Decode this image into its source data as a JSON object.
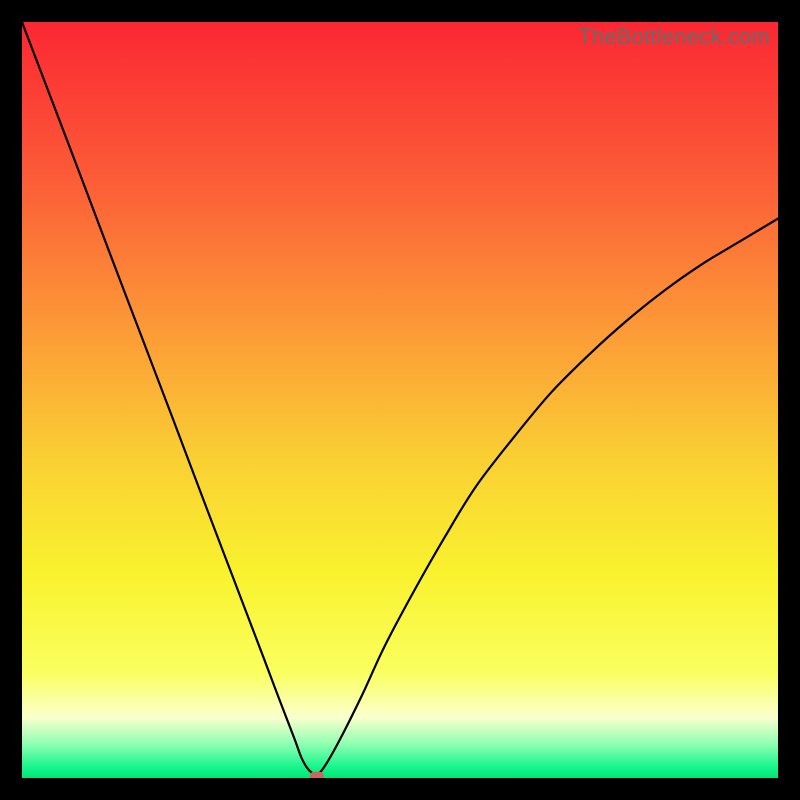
{
  "watermark": "TheBottleneck.com",
  "chart_data": {
    "type": "line",
    "title": "",
    "xlabel": "",
    "ylabel": "",
    "xlim": [
      0,
      100
    ],
    "ylim": [
      0,
      100
    ],
    "x": [
      0,
      4,
      8,
      12,
      16,
      20,
      24,
      28,
      32,
      34,
      36,
      37,
      38,
      39,
      40,
      42,
      45,
      48,
      52,
      56,
      60,
      65,
      70,
      75,
      80,
      85,
      90,
      95,
      100
    ],
    "values": [
      100,
      89.5,
      79,
      68.4,
      57.9,
      47.4,
      36.8,
      26.3,
      15.8,
      10.5,
      5.3,
      2.6,
      1,
      0.5,
      1.5,
      5,
      11,
      17.5,
      25,
      32,
      38.5,
      45,
      51,
      56,
      60.5,
      64.5,
      68,
      71,
      74
    ],
    "minimum_marker": {
      "x": 39,
      "y": 0.3
    },
    "background_gradient": {
      "type": "vertical",
      "stops": [
        {
          "offset": 0.0,
          "color": "#fb2733"
        },
        {
          "offset": 0.2,
          "color": "#fc5a37"
        },
        {
          "offset": 0.4,
          "color": "#fc9837"
        },
        {
          "offset": 0.58,
          "color": "#fad033"
        },
        {
          "offset": 0.73,
          "color": "#f9f22e"
        },
        {
          "offset": 0.86,
          "color": "#faff5e"
        },
        {
          "offset": 0.92,
          "color": "#fbffce"
        },
        {
          "offset": 0.955,
          "color": "#8fffb2"
        },
        {
          "offset": 0.985,
          "color": "#19f58d"
        },
        {
          "offset": 1.0,
          "color": "#00e676"
        }
      ]
    }
  }
}
